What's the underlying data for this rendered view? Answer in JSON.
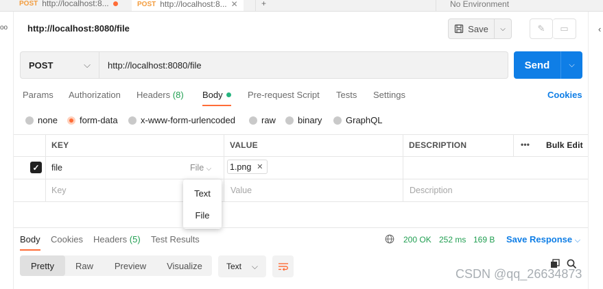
{
  "tabs": [
    {
      "method": "POST",
      "title": "http://localhost:8..."
    },
    {
      "method": "POST",
      "title": "http://localhost:8..."
    }
  ],
  "new_tab": "+",
  "environment": "No Environment",
  "request": {
    "title": "http://localhost:8080/file",
    "save_label": "Save",
    "method": "POST",
    "url": "http://localhost:8080/file",
    "send_label": "Send"
  },
  "request_tabs": {
    "params": "Params",
    "authorization": "Authorization",
    "headers": "Headers",
    "headers_count": "(8)",
    "body": "Body",
    "prerequest": "Pre-request Script",
    "tests": "Tests",
    "settings": "Settings",
    "cookies": "Cookies"
  },
  "body_modes": [
    "none",
    "form-data",
    "x-www-form-urlencoded",
    "raw",
    "binary",
    "GraphQL"
  ],
  "body_mode_selected": "form-data",
  "table": {
    "headers": {
      "key": "KEY",
      "value": "VALUE",
      "description": "DESCRIPTION",
      "more": "•••",
      "bulk_edit": "Bulk Edit"
    },
    "row": {
      "checked": true,
      "key": "file",
      "type": "File",
      "value": "1.png"
    },
    "placeholders": {
      "key": "Key",
      "value": "Value",
      "description": "Description"
    }
  },
  "type_menu": [
    "Text",
    "File"
  ],
  "response": {
    "tabs": {
      "body": "Body",
      "cookies": "Cookies",
      "headers": "Headers",
      "headers_count": "(5)",
      "tests": "Test Results"
    },
    "status": "200 OK",
    "time": "252 ms",
    "size": "169 B",
    "save_label": "Save Response",
    "view_modes": [
      "Pretty",
      "Raw",
      "Preview",
      "Visualize"
    ],
    "view_selected": "Pretty",
    "format": "Text"
  },
  "watermark": "CSDN @qq_26634873",
  "colors": {
    "accent": "#ff6c37",
    "primary": "#0f7ee6",
    "success": "#1f9e50"
  }
}
